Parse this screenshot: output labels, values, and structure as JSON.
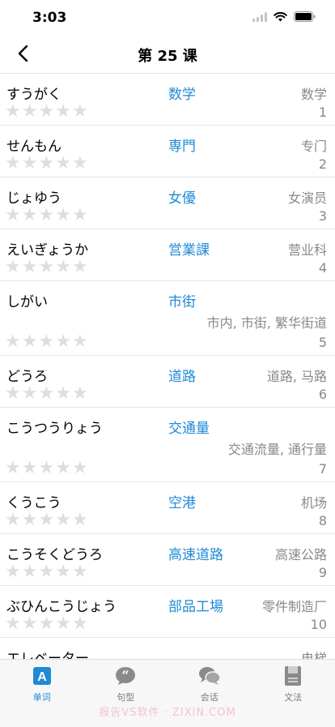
{
  "status": {
    "time": "3:03"
  },
  "nav": {
    "title": "第 25 课"
  },
  "colors": {
    "accent": "#1f8ad6",
    "star_empty": "#dedede",
    "secondary_text": "#888888"
  },
  "words": [
    {
      "kana": "すうがく",
      "kanji": "数学",
      "meaning": "数学",
      "index": "1",
      "stars": 0
    },
    {
      "kana": "せんもん",
      "kanji": "専門",
      "meaning": "专门",
      "index": "2",
      "stars": 0
    },
    {
      "kana": "じょゆう",
      "kanji": "女優",
      "meaning": "女演员",
      "index": "3",
      "stars": 0
    },
    {
      "kana": "えいぎょうか",
      "kanji": "営業課",
      "meaning": "营业科",
      "index": "4",
      "stars": 0
    },
    {
      "kana": "しがい",
      "kanji": "市街",
      "meaning": "市内, 市街, 繁华街道",
      "index": "5",
      "stars": 0
    },
    {
      "kana": "どうろ",
      "kanji": "道路",
      "meaning": "道路, 马路",
      "index": "6",
      "stars": 0
    },
    {
      "kana": "こうつうりょう",
      "kanji": "交通量",
      "meaning": "交通流量, 通行量",
      "index": "7",
      "stars": 0
    },
    {
      "kana": "くうこう",
      "kanji": "空港",
      "meaning": "机场",
      "index": "8",
      "stars": 0
    },
    {
      "kana": "こうそくどうろ",
      "kanji": "高速道路",
      "meaning": "高速公路",
      "index": "9",
      "stars": 0
    },
    {
      "kana": "ぶひんこうじょう",
      "kanji": "部品工場",
      "meaning": "零件制造厂",
      "index": "10",
      "stars": 0
    },
    {
      "kana": "エレベーター",
      "kanji": "",
      "meaning": "电梯",
      "index": "",
      "stars": 0
    }
  ],
  "tabs": [
    {
      "label": "单词",
      "icon": "letter-a-icon",
      "active": true
    },
    {
      "label": "句型",
      "icon": "quote-bubble-icon",
      "active": false
    },
    {
      "label": "会话",
      "icon": "chat-bubbles-icon",
      "active": false
    },
    {
      "label": "文法",
      "icon": "document-icon",
      "active": false
    }
  ],
  "watermark": "报告VS软件 · ZIXIN.COM"
}
